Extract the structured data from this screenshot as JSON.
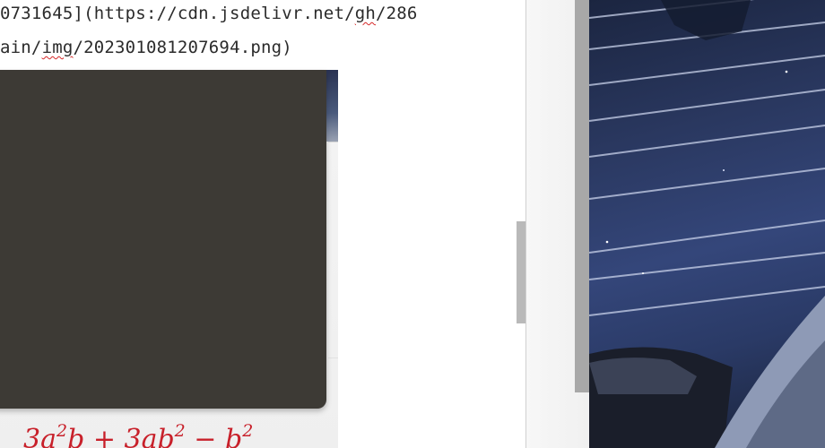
{
  "editor": {
    "line_1_prefix": "0731645](https://cdn.jsdelivr.net/",
    "line_1_squiggle": "gh",
    "line_1_suffix": "/286",
    "line_2_prefix": "ain/",
    "line_2_squiggle": "img",
    "line_2_suffix": "/202301081207694.png)"
  },
  "embed": {
    "formula_coef_1": "3a",
    "formula_exp_1": "2",
    "formula_mid_1": "b + 3ab",
    "formula_exp_2": "2",
    "formula_mid_2": " − b",
    "formula_exp_3": "2"
  },
  "colors": {
    "popup_background": "#3d3a35",
    "formula_red": "#c8202a",
    "squiggle_red": "#d72a2a",
    "scroll_thumb": "#b9b9b9",
    "wallpaper_navy": "#2a3860"
  },
  "icons": {
    "wallpaper": "night-sky-wallpaper-image"
  }
}
